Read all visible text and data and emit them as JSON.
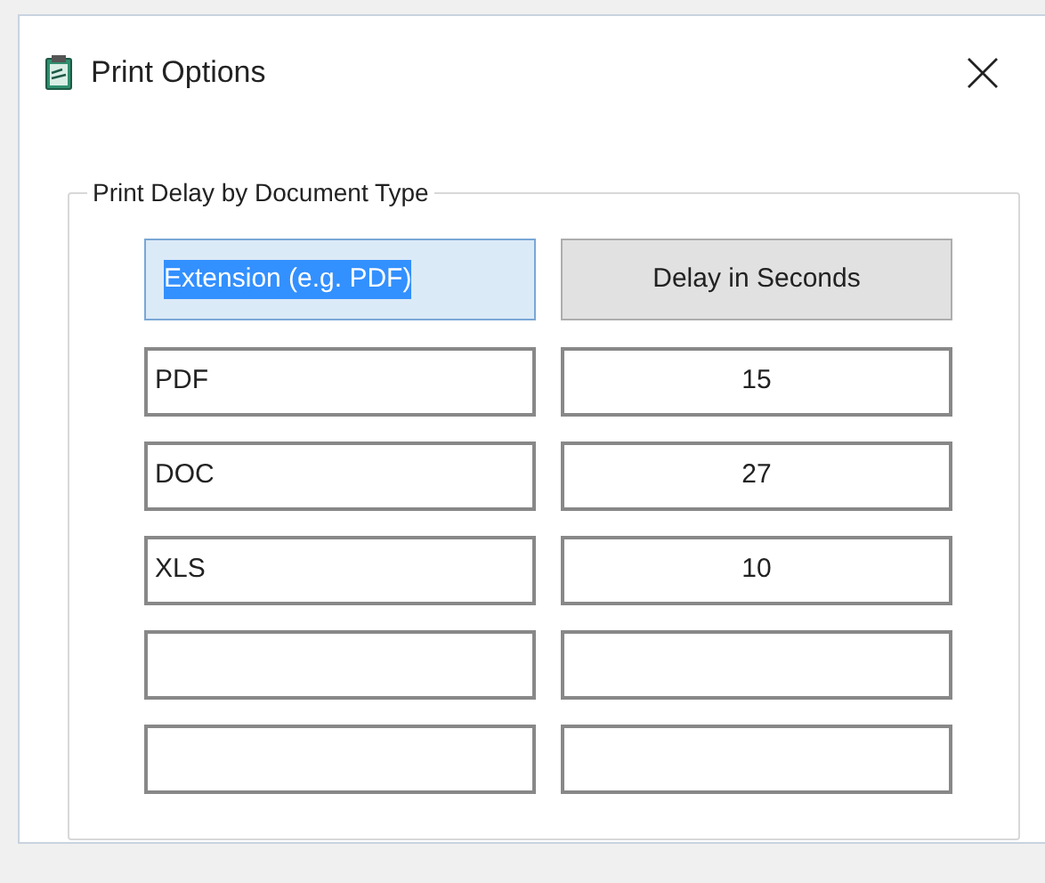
{
  "window": {
    "title": "Print Options"
  },
  "group": {
    "label": "Print Delay by Document Type",
    "header": {
      "extension": {
        "value": "Extension (e.g. PDF)",
        "text_selected": true
      },
      "delay": {
        "label": "Delay in Seconds"
      }
    },
    "rows": [
      {
        "extension": "PDF",
        "delay": "15"
      },
      {
        "extension": "DOC",
        "delay": "27"
      },
      {
        "extension": "XLS",
        "delay": "10"
      },
      {
        "extension": null,
        "delay": null
      },
      {
        "extension": null,
        "delay": null
      }
    ]
  }
}
